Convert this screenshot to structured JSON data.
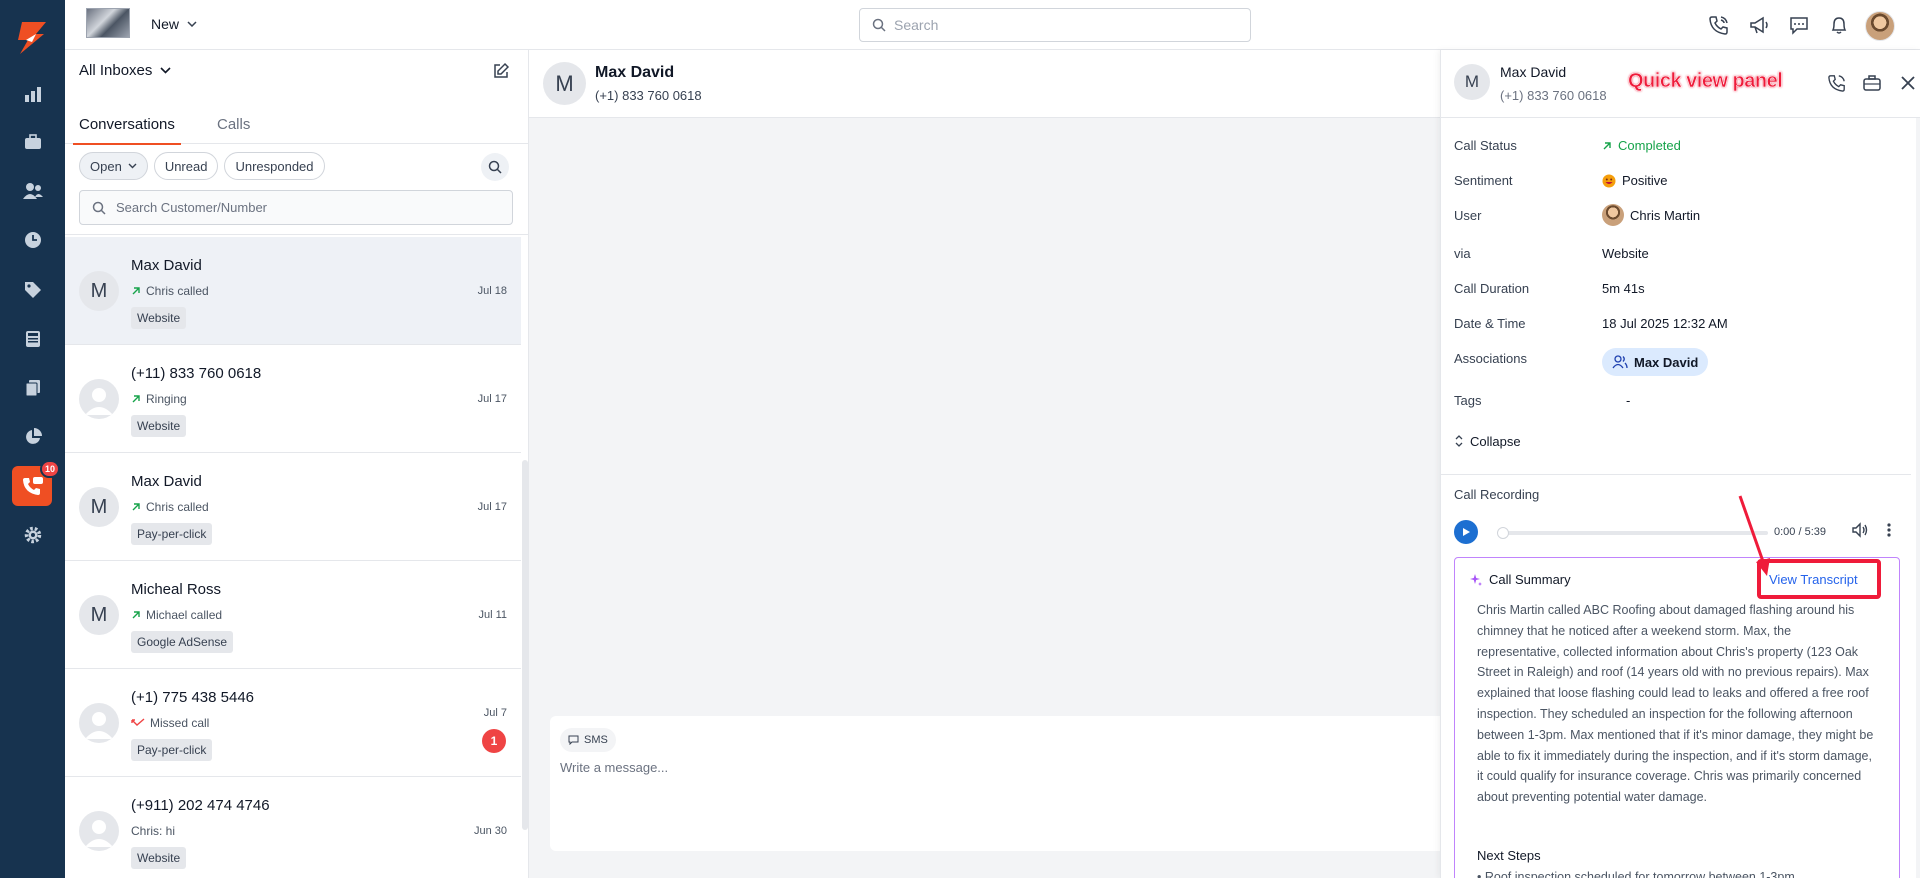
{
  "rail": {
    "badge_count": "10",
    "items": [
      "reports",
      "briefcase",
      "contacts",
      "history",
      "tags",
      "calculator",
      "documents",
      "pie-chart",
      "calls",
      "settings"
    ]
  },
  "topbar": {
    "new_label": "New",
    "search_placeholder": "Search"
  },
  "inbox": {
    "title": "All Inboxes",
    "tabs": [
      {
        "label": "Conversations"
      },
      {
        "label": "Calls"
      }
    ],
    "filters": {
      "open": "Open",
      "unread": "Unread",
      "unresponded": "Unresponded"
    },
    "search_placeholder": "Search Customer/Number",
    "conversations": [
      {
        "initial": "M",
        "name": "Max David",
        "status": "Chris called",
        "tag": "Website",
        "date": "Jul 18"
      },
      {
        "initial": "",
        "name": "(+11) 833 760 0618",
        "status": "Ringing",
        "tag": "Website",
        "date": "Jul 17"
      },
      {
        "initial": "M",
        "name": "Max David",
        "status": "Chris called",
        "tag": "Pay-per-click",
        "date": "Jul 17"
      },
      {
        "initial": "M",
        "name": "Micheal Ross",
        "status": "Michael called",
        "tag": "Google AdSense",
        "date": "Jul 11"
      },
      {
        "initial": "",
        "name": "(+1) 775 438 5446",
        "status": "Missed call",
        "tag": "Pay-per-click",
        "date": "Jul 7",
        "unread": "1"
      },
      {
        "initial": "",
        "name": "(+911) 202 474 4746",
        "status": "Chris: hi",
        "tag": "Website",
        "date": "Jun 30"
      }
    ]
  },
  "chat": {
    "initial": "M",
    "name": "Max David",
    "phone": "(+1) 833 760 0618",
    "sms_label": "SMS",
    "composer_placeholder": "Write a message..."
  },
  "quick_view": {
    "initial": "M",
    "name": "Max David",
    "phone": "(+1) 833 760 0618",
    "annotation": "Quick view panel",
    "details": {
      "call_status_label": "Call Status",
      "call_status": "Completed",
      "sentiment_label": "Sentiment",
      "sentiment": "Positive",
      "user_label": "User",
      "user": "Chris Martin",
      "via_label": "via",
      "via": "Website",
      "duration_label": "Call Duration",
      "duration": "5m 41s",
      "datetime_label": "Date & Time",
      "datetime": "18 Jul 2025 12:32 AM",
      "associations_label": "Associations",
      "association": "Max David",
      "tags_label": "Tags",
      "tags": "-"
    },
    "collapse_label": "Collapse",
    "recording_title": "Call Recording",
    "recording_time": "0:00 / 5:39",
    "recording_progress": 0,
    "summary_title": "Call Summary",
    "view_transcript": "View Transcript",
    "summary_text": "Chris Martin called ABC Roofing about damaged flashing around his chimney that he noticed after a weekend storm. Max, the representative, collected information about Chris's property (123 Oak Street in Raleigh) and roof (14 years old with no previous repairs). Max explained that loose flashing could lead to leaks and offered a free roof inspection. They scheduled an inspection for the following afternoon between 1-3pm. Max mentioned that if it's minor damage, they might be able to fix it immediately during the inspection, and if it's storm damage, it could qualify for insurance coverage. Chris was primarily concerned about preventing potential water damage.",
    "next_steps_title": "Next Steps",
    "next_steps": [
      "Roof inspection scheduled for tomorrow between 1-3pm"
    ]
  },
  "colors": {
    "rail": "#17334f",
    "accent": "#ef4f23",
    "annotation": "#ef1b3a",
    "success": "#16a34a",
    "link": "#2563eb"
  }
}
